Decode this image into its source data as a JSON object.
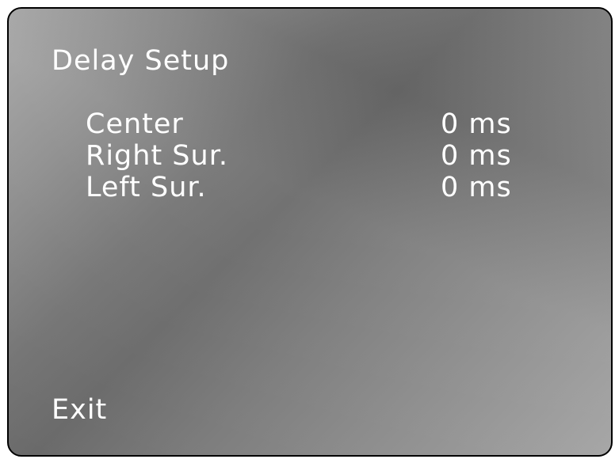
{
  "menu": {
    "title": "Delay Setup",
    "items": [
      {
        "label": "Center",
        "value": "0 ms"
      },
      {
        "label": "Right Sur.",
        "value": "0 ms"
      },
      {
        "label": "Left Sur.",
        "value": "0 ms"
      }
    ],
    "exit_label": "Exit"
  },
  "colors": {
    "text": "#ffffff",
    "border": "#000000",
    "panel_light": "#a8a8a8",
    "panel_dark": "#6a6a6a"
  }
}
